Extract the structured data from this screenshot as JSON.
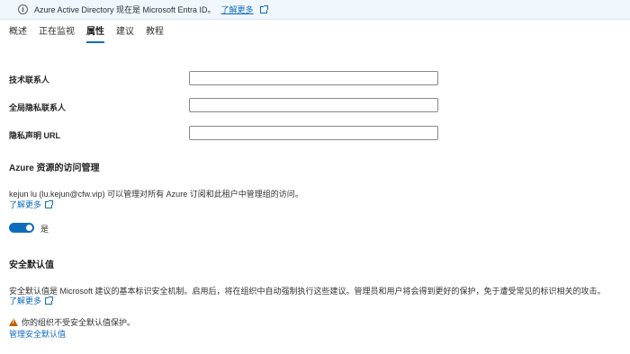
{
  "banner": {
    "icon": "info-icon",
    "message": "Azure Active Directory 现在是 Microsoft Entra ID。",
    "link_label": "了解更多"
  },
  "tabs": [
    {
      "label": "概述",
      "active": false
    },
    {
      "label": "正在监视",
      "active": false
    },
    {
      "label": "属性",
      "active": true
    },
    {
      "label": "建议",
      "active": false
    },
    {
      "label": "教程",
      "active": false
    }
  ],
  "form": {
    "tech_contact_label": "技术联系人",
    "tech_contact_value": "",
    "privacy_contact_label": "全局隐私联系人",
    "privacy_contact_value": "",
    "privacy_url_label": "隐私声明 URL",
    "privacy_url_value": ""
  },
  "access": {
    "title": "Azure 资源的访问管理",
    "description": "kejun lu (lu.kejun@cfw.vip) 可以管理对所有 Azure 订阅和此租户中管理组的访问。",
    "learn_more": "了解更多",
    "toggle_label": "是",
    "toggle_on": true
  },
  "security": {
    "title": "安全默认值",
    "description": "安全默认值是 Microsoft 建议的基本标识安全机制。启用后，将在组织中自动强制执行这些建议。管理员和用户将会得到更好的保护，免于遭受常见的标识相关的攻击。",
    "learn_more": "了解更多",
    "warning": "你的组织不受安全默认值保护。",
    "manage_link": "管理安全默认值"
  },
  "colors": {
    "accent": "#0f6cbd",
    "banner_bg": "#eff6fc",
    "warning": "#c45f00"
  }
}
